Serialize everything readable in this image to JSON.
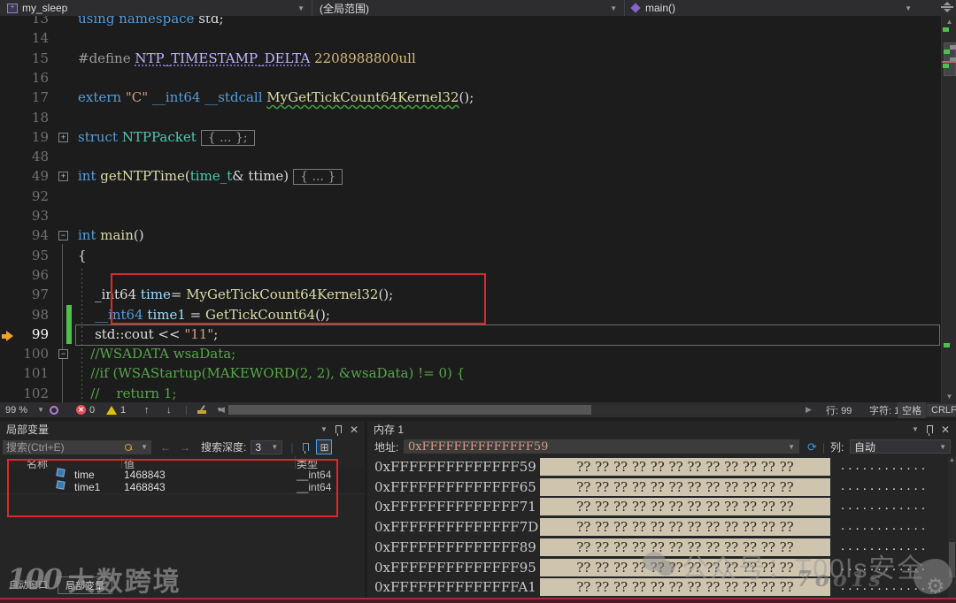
{
  "nav": {
    "project": "my_sleep",
    "scope": "(全局范围)",
    "member": "main()"
  },
  "editor": {
    "lines": [
      {
        "num": "13",
        "seg": [
          [
            "kw",
            "using namespace "
          ],
          [
            "plain",
            "std;"
          ]
        ]
      },
      {
        "num": "14",
        "seg": []
      },
      {
        "num": "15",
        "seg": [
          [
            "pp",
            "#define "
          ],
          [
            "macro",
            "NTP_TIMESTAMP_DELTA"
          ],
          [
            "num",
            " 2208988800ull"
          ]
        ]
      },
      {
        "num": "16",
        "seg": []
      },
      {
        "num": "17",
        "seg": [
          [
            "kw",
            "extern "
          ],
          [
            "str",
            "\"C\" "
          ],
          [
            "kw",
            "__int64 __stdcall "
          ],
          [
            "fnw",
            "MyGetTickCount64Kernel32"
          ],
          [
            "plain",
            "();"
          ]
        ]
      },
      {
        "num": "18",
        "seg": []
      },
      {
        "num": "19",
        "fold": "+",
        "seg": [
          [
            "kw",
            "struct "
          ],
          [
            "type",
            "NTPPacket"
          ],
          [
            "box",
            "{ ... };"
          ]
        ]
      },
      {
        "num": "48",
        "seg": []
      },
      {
        "num": "49",
        "fold": "+",
        "seg": [
          [
            "kw",
            "int "
          ],
          [
            "fn",
            "getNTPTime"
          ],
          [
            "plain",
            "("
          ],
          [
            "type",
            "time_t"
          ],
          [
            "plain",
            "& ttime)"
          ],
          [
            "box",
            "{ ... }"
          ]
        ]
      },
      {
        "num": "92",
        "seg": []
      },
      {
        "num": "93",
        "seg": []
      },
      {
        "num": "94",
        "fold": "-",
        "seg": [
          [
            "kw",
            "int "
          ],
          [
            "fn",
            "main"
          ],
          [
            "plain",
            "()"
          ]
        ]
      },
      {
        "num": "95",
        "seg": [
          [
            "plain",
            "{"
          ]
        ]
      },
      {
        "num": "96",
        "seg": []
      },
      {
        "num": "97",
        "seg": [
          [
            "plain",
            "    _int64 "
          ],
          [
            "var",
            "time"
          ],
          [
            "plain",
            "= "
          ],
          [
            "fn",
            "MyGetTickCount64Kernel32"
          ],
          [
            "plain",
            "();"
          ]
        ]
      },
      {
        "num": "98",
        "change": true,
        "seg": [
          [
            "kw",
            "    __int64 "
          ],
          [
            "var",
            "time1"
          ],
          [
            "plain",
            " = "
          ],
          [
            "fn",
            "GetTickCount64"
          ],
          [
            "plain",
            "();"
          ]
        ]
      },
      {
        "num": "99",
        "change": true,
        "cur": true,
        "seg": [
          [
            "plain",
            "    std::cout << "
          ],
          [
            "str",
            "\"11\""
          ],
          [
            "plain",
            ";"
          ]
        ]
      },
      {
        "num": "100",
        "fold": "-",
        "seg": [
          [
            "cmt",
            "   //WSADATA wsaData;"
          ]
        ]
      },
      {
        "num": "101",
        "seg": [
          [
            "cmt",
            "   //if (WSAStartup(MAKEWORD(2, 2), &wsaData) != 0) {"
          ]
        ]
      },
      {
        "num": "102",
        "seg": [
          [
            "cmt",
            "   //    return 1;"
          ]
        ]
      }
    ],
    "status": {
      "zoom_level": "99 %",
      "error_count": "0",
      "warning_count": "1",
      "line": "行: 99",
      "column": "字符: 1",
      "spaces": "空格",
      "line_ending": "CRLF"
    }
  },
  "locals": {
    "title": "局部变量",
    "search_placeholder": "搜索(Ctrl+E)",
    "depth_label": "搜索深度:",
    "depth_value": "3",
    "columns": [
      "名称",
      "值",
      "类型"
    ],
    "rows": [
      {
        "name": "time",
        "value": "1468843",
        "type": "__int64"
      },
      {
        "name": "time1",
        "value": "1468843",
        "type": "__int64"
      }
    ],
    "tabs": [
      {
        "label": "自动窗口",
        "active": false
      },
      {
        "label": "局部变量",
        "active": true
      }
    ]
  },
  "memory": {
    "title": "内存 1",
    "address_label": "地址:",
    "address_value": "0xFFFFFFFFFFFFFF59",
    "columns_label": "列:",
    "columns_value": "自动",
    "rows": [
      {
        "address": "0xFFFFFFFFFFFFFF59",
        "bytes": "?? ?? ?? ?? ?? ?? ?? ?? ?? ?? ?? ??",
        "ascii": ". . . . . . . . . . . ."
      },
      {
        "address": "0xFFFFFFFFFFFFFF65",
        "bytes": "?? ?? ?? ?? ?? ?? ?? ?? ?? ?? ?? ??",
        "ascii": ". . . . . . . . . . . ."
      },
      {
        "address": "0xFFFFFFFFFFFFFF71",
        "bytes": "?? ?? ?? ?? ?? ?? ?? ?? ?? ?? ?? ??",
        "ascii": ". . . . . . . . . . . ."
      },
      {
        "address": "0xFFFFFFFFFFFFFF7D",
        "bytes": "?? ?? ?? ?? ?? ?? ?? ?? ?? ?? ?? ??",
        "ascii": ". . . . . . . . . . . ."
      },
      {
        "address": "0xFFFFFFFFFFFFFF89",
        "bytes": "?? ?? ?? ?? ?? ?? ?? ?? ?? ?? ?? ??",
        "ascii": ". . . . . . . . . . . ."
      },
      {
        "address": "0xFFFFFFFFFFFFFF95",
        "bytes": "?? ?? ?? ?? ?? ?? ?? ?? ?? ?? ?? ??",
        "ascii": ". . . . . . . . . . . ."
      },
      {
        "address": "0xFFFFFFFFFFFFFFA1",
        "bytes": "?? ?? ?? ?? ?? ?? ?? ?? ?? ?? ?? ??",
        "ascii": ". . . . . . . . . . . ."
      }
    ]
  },
  "watermarks": {
    "brand_left_logo": "100",
    "brand_left": "大数跨境",
    "wechat_text": "公众号：T00ls安全",
    "splash_text": "7oo1s"
  },
  "colors": {
    "annotation_red": "#d62b2b",
    "change_tracker_green": "#4cc24c",
    "instruction_pointer": "#f0a030",
    "memory_changed_bg": "#cfc4ae",
    "keyword_blue": "#569cd6",
    "comment_green": "#57a64a"
  }
}
